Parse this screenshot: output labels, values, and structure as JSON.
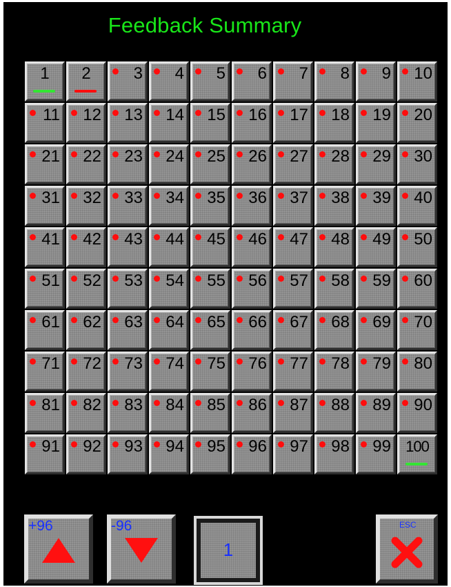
{
  "title": "Feedback Summary",
  "colors": {
    "title": "#19e619",
    "status_fault": "#ff0d0d",
    "status_ok": "#33e633",
    "status_alarm": "#ff0d0d",
    "accent_text": "#1830ff"
  },
  "grid": {
    "cells": [
      {
        "label": "1",
        "indicator": "bar-green"
      },
      {
        "label": "2",
        "indicator": "bar-red"
      },
      {
        "label": "3",
        "indicator": "dot-red"
      },
      {
        "label": "4",
        "indicator": "dot-red"
      },
      {
        "label": "5",
        "indicator": "dot-red"
      },
      {
        "label": "6",
        "indicator": "dot-red"
      },
      {
        "label": "7",
        "indicator": "dot-red"
      },
      {
        "label": "8",
        "indicator": "dot-red"
      },
      {
        "label": "9",
        "indicator": "dot-red"
      },
      {
        "label": "10",
        "indicator": "dot-red"
      },
      {
        "label": "11",
        "indicator": "dot-red"
      },
      {
        "label": "12",
        "indicator": "dot-red"
      },
      {
        "label": "13",
        "indicator": "dot-red"
      },
      {
        "label": "14",
        "indicator": "dot-red"
      },
      {
        "label": "15",
        "indicator": "dot-red"
      },
      {
        "label": "16",
        "indicator": "dot-red"
      },
      {
        "label": "17",
        "indicator": "dot-red"
      },
      {
        "label": "18",
        "indicator": "dot-red"
      },
      {
        "label": "19",
        "indicator": "dot-red"
      },
      {
        "label": "20",
        "indicator": "dot-red"
      },
      {
        "label": "21",
        "indicator": "dot-red"
      },
      {
        "label": "22",
        "indicator": "dot-red"
      },
      {
        "label": "23",
        "indicator": "dot-red"
      },
      {
        "label": "24",
        "indicator": "dot-red"
      },
      {
        "label": "25",
        "indicator": "dot-red"
      },
      {
        "label": "26",
        "indicator": "dot-red"
      },
      {
        "label": "27",
        "indicator": "dot-red"
      },
      {
        "label": "28",
        "indicator": "dot-red"
      },
      {
        "label": "29",
        "indicator": "dot-red"
      },
      {
        "label": "30",
        "indicator": "dot-red"
      },
      {
        "label": "31",
        "indicator": "dot-red"
      },
      {
        "label": "32",
        "indicator": "dot-red"
      },
      {
        "label": "33",
        "indicator": "dot-red"
      },
      {
        "label": "34",
        "indicator": "dot-red"
      },
      {
        "label": "35",
        "indicator": "dot-red"
      },
      {
        "label": "36",
        "indicator": "dot-red"
      },
      {
        "label": "37",
        "indicator": "dot-red"
      },
      {
        "label": "38",
        "indicator": "dot-red"
      },
      {
        "label": "39",
        "indicator": "dot-red"
      },
      {
        "label": "40",
        "indicator": "dot-red"
      },
      {
        "label": "41",
        "indicator": "dot-red"
      },
      {
        "label": "42",
        "indicator": "dot-red"
      },
      {
        "label": "43",
        "indicator": "dot-red"
      },
      {
        "label": "44",
        "indicator": "dot-red"
      },
      {
        "label": "45",
        "indicator": "dot-red"
      },
      {
        "label": "46",
        "indicator": "dot-red"
      },
      {
        "label": "47",
        "indicator": "dot-red"
      },
      {
        "label": "48",
        "indicator": "dot-red"
      },
      {
        "label": "49",
        "indicator": "dot-red"
      },
      {
        "label": "50",
        "indicator": "dot-red"
      },
      {
        "label": "51",
        "indicator": "dot-red"
      },
      {
        "label": "52",
        "indicator": "dot-red"
      },
      {
        "label": "53",
        "indicator": "dot-red"
      },
      {
        "label": "54",
        "indicator": "dot-red"
      },
      {
        "label": "55",
        "indicator": "dot-red"
      },
      {
        "label": "56",
        "indicator": "dot-red"
      },
      {
        "label": "57",
        "indicator": "dot-red"
      },
      {
        "label": "58",
        "indicator": "dot-red"
      },
      {
        "label": "59",
        "indicator": "dot-red"
      },
      {
        "label": "60",
        "indicator": "dot-red"
      },
      {
        "label": "61",
        "indicator": "dot-red"
      },
      {
        "label": "62",
        "indicator": "dot-red"
      },
      {
        "label": "63",
        "indicator": "dot-red"
      },
      {
        "label": "64",
        "indicator": "dot-red"
      },
      {
        "label": "65",
        "indicator": "dot-red"
      },
      {
        "label": "66",
        "indicator": "dot-red"
      },
      {
        "label": "67",
        "indicator": "dot-red"
      },
      {
        "label": "68",
        "indicator": "dot-red"
      },
      {
        "label": "69",
        "indicator": "dot-red"
      },
      {
        "label": "70",
        "indicator": "dot-red"
      },
      {
        "label": "71",
        "indicator": "dot-red"
      },
      {
        "label": "72",
        "indicator": "dot-red"
      },
      {
        "label": "73",
        "indicator": "dot-red"
      },
      {
        "label": "74",
        "indicator": "dot-red"
      },
      {
        "label": "75",
        "indicator": "dot-red"
      },
      {
        "label": "76",
        "indicator": "dot-red"
      },
      {
        "label": "77",
        "indicator": "dot-red"
      },
      {
        "label": "78",
        "indicator": "dot-red"
      },
      {
        "label": "79",
        "indicator": "dot-red"
      },
      {
        "label": "80",
        "indicator": "dot-red"
      },
      {
        "label": "81",
        "indicator": "dot-red"
      },
      {
        "label": "82",
        "indicator": "dot-red"
      },
      {
        "label": "83",
        "indicator": "dot-red"
      },
      {
        "label": "84",
        "indicator": "dot-red"
      },
      {
        "label": "85",
        "indicator": "dot-red"
      },
      {
        "label": "86",
        "indicator": "dot-red"
      },
      {
        "label": "87",
        "indicator": "dot-red"
      },
      {
        "label": "88",
        "indicator": "dot-red"
      },
      {
        "label": "89",
        "indicator": "dot-red"
      },
      {
        "label": "90",
        "indicator": "dot-red"
      },
      {
        "label": "91",
        "indicator": "dot-red"
      },
      {
        "label": "92",
        "indicator": "dot-red"
      },
      {
        "label": "93",
        "indicator": "dot-red"
      },
      {
        "label": "94",
        "indicator": "dot-red"
      },
      {
        "label": "95",
        "indicator": "dot-red"
      },
      {
        "label": "96",
        "indicator": "dot-red"
      },
      {
        "label": "97",
        "indicator": "dot-red"
      },
      {
        "label": "98",
        "indicator": "dot-red"
      },
      {
        "label": "99",
        "indicator": "dot-red"
      },
      {
        "label": "100",
        "indicator": "bar-green"
      }
    ]
  },
  "controls": {
    "page_up": {
      "label": "+96",
      "icon": "triangle-up-icon"
    },
    "page_down": {
      "label": "-96",
      "icon": "triangle-down-icon"
    },
    "page_value": "1",
    "esc": {
      "label": "ESC",
      "icon": "x-close-icon"
    }
  }
}
